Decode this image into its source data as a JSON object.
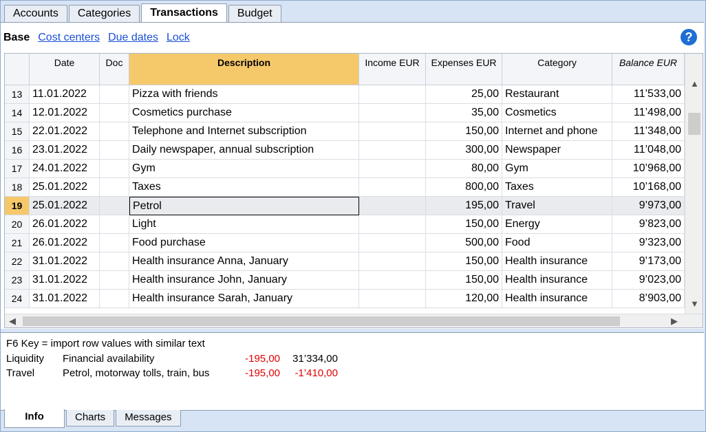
{
  "top_tabs": [
    {
      "label": "Accounts"
    },
    {
      "label": "Categories"
    },
    {
      "label": "Transactions",
      "active": true
    },
    {
      "label": "Budget"
    }
  ],
  "viewbar": {
    "base": "Base",
    "links": [
      "Cost centers",
      "Due dates",
      "Lock"
    ]
  },
  "help_icon": {
    "glyph": "?",
    "color": "#1f6ed4"
  },
  "table": {
    "headers": {
      "date": "Date",
      "doc": "Doc",
      "description": "Description",
      "income": "Income EUR",
      "expenses": "Expenses EUR",
      "category": "Category",
      "balance": "Balance EUR"
    },
    "rows": [
      {
        "n": "13",
        "date": "11.01.2022",
        "doc": "",
        "description": "Pizza with friends",
        "income": "",
        "expenses": "25,00",
        "category": "Restaurant",
        "balance": "11’533,00"
      },
      {
        "n": "14",
        "date": "12.01.2022",
        "doc": "",
        "description": "Cosmetics purchase",
        "income": "",
        "expenses": "35,00",
        "category": "Cosmetics",
        "balance": "11’498,00"
      },
      {
        "n": "15",
        "date": "22.01.2022",
        "doc": "",
        "description": "Telephone and Internet subscription",
        "income": "",
        "expenses": "150,00",
        "category": "Internet and phone",
        "balance": "11’348,00"
      },
      {
        "n": "16",
        "date": "23.01.2022",
        "doc": "",
        "description": "Daily newspaper, annual subscription",
        "income": "",
        "expenses": "300,00",
        "category": "Newspaper",
        "balance": "11’048,00"
      },
      {
        "n": "17",
        "date": "24.01.2022",
        "doc": "",
        "description": "Gym",
        "income": "",
        "expenses": "80,00",
        "category": "Gym",
        "balance": "10’968,00"
      },
      {
        "n": "18",
        "date": "25.01.2022",
        "doc": "",
        "description": "Taxes",
        "income": "",
        "expenses": "800,00",
        "category": "Taxes",
        "balance": "10’168,00"
      },
      {
        "n": "19",
        "date": "25.01.2022",
        "doc": "",
        "description": "Petrol",
        "income": "",
        "expenses": "195,00",
        "category": "Travel",
        "balance": "9’973,00",
        "selected": true
      },
      {
        "n": "20",
        "date": "26.01.2022",
        "doc": "",
        "description": "Light",
        "income": "",
        "expenses": "150,00",
        "category": "Energy",
        "balance": "9’823,00"
      },
      {
        "n": "21",
        "date": "26.01.2022",
        "doc": "",
        "description": "Food purchase",
        "income": "",
        "expenses": "500,00",
        "category": "Food",
        "balance": "9’323,00"
      },
      {
        "n": "22",
        "date": "31.01.2022",
        "doc": "",
        "description": "Health insurance Anna, January",
        "income": "",
        "expenses": "150,00",
        "category": "Health insurance",
        "balance": "9’173,00"
      },
      {
        "n": "23",
        "date": "31.01.2022",
        "doc": "",
        "description": "Health insurance John, January",
        "income": "",
        "expenses": "150,00",
        "category": "Health insurance",
        "balance": "9’023,00"
      },
      {
        "n": "24",
        "date": "31.01.2022",
        "doc": "",
        "description": "Health insurance Sarah, January",
        "income": "",
        "expenses": "120,00",
        "category": "Health insurance",
        "balance": "8’903,00"
      }
    ]
  },
  "info": {
    "hint": "F6 Key = import row values with similar text",
    "lines": [
      {
        "account": "Liquidity",
        "name": "Financial availability",
        "amount": "-195,00",
        "balance": "31’334,00",
        "balance_red": false
      },
      {
        "account": "Travel",
        "name": "Petrol, motorway tolls, train, bus",
        "amount": "-195,00",
        "balance": "-1’410,00",
        "balance_red": true
      }
    ]
  },
  "bottom_tabs": [
    {
      "label": "Info",
      "active": true
    },
    {
      "label": "Charts"
    },
    {
      "label": "Messages"
    }
  ],
  "colors": {
    "selected_header": "#f5c86a",
    "link": "#1a4fd6",
    "negative": "#e00000",
    "background": "#d6e4f5"
  }
}
